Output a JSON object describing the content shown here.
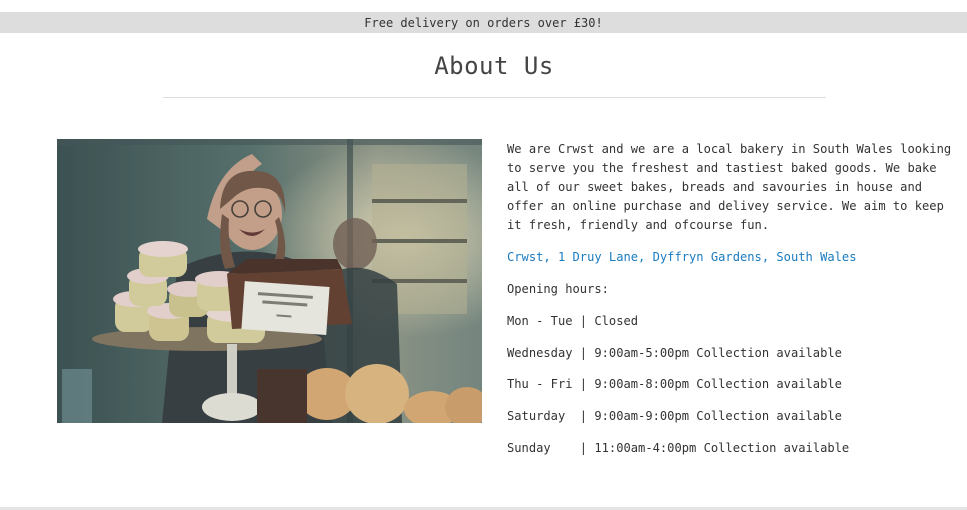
{
  "banner": {
    "text": "Free delivery on orders over £30!"
  },
  "page": {
    "title": "About Us"
  },
  "photo": {
    "icon": "bakery-photo",
    "colors": {
      "shelf_wall": "#3f5a5c",
      "window_glow": "#c9c2a8",
      "cake_pink": "#e8c6c2",
      "cake_yellow": "#d9cf9a",
      "bread": "#d9a46b",
      "dark_apron": "#2a2f34"
    }
  },
  "about": {
    "description": "We are Crwst and we are a local bakery in South Wales looking to serve you the freshest and tastiest baked goods. We bake all of our sweet bakes, breads and savouries in house and offer an online purchase and delivey service. We aim to keep it fresh, friendly and ofcourse fun.",
    "address": "Crwst, 1 Druy Lane, Dyffryn Gardens, South Wales",
    "hours_heading": "Opening hours:",
    "hours": [
      "Mon - Tue | Closed",
      "Wednesday | 9:00am-5:00pm Collection available",
      "Thu - Fri | 9:00am-8:00pm Collection available",
      "Saturday  | 9:00am-9:00pm Collection available",
      "Sunday    | 11:00am-4:00pm Collection available"
    ]
  },
  "colors": {
    "banner_bg": "#dddddd",
    "link": "#1a7bbf",
    "text": "#333333",
    "rule": "#dddddd"
  }
}
